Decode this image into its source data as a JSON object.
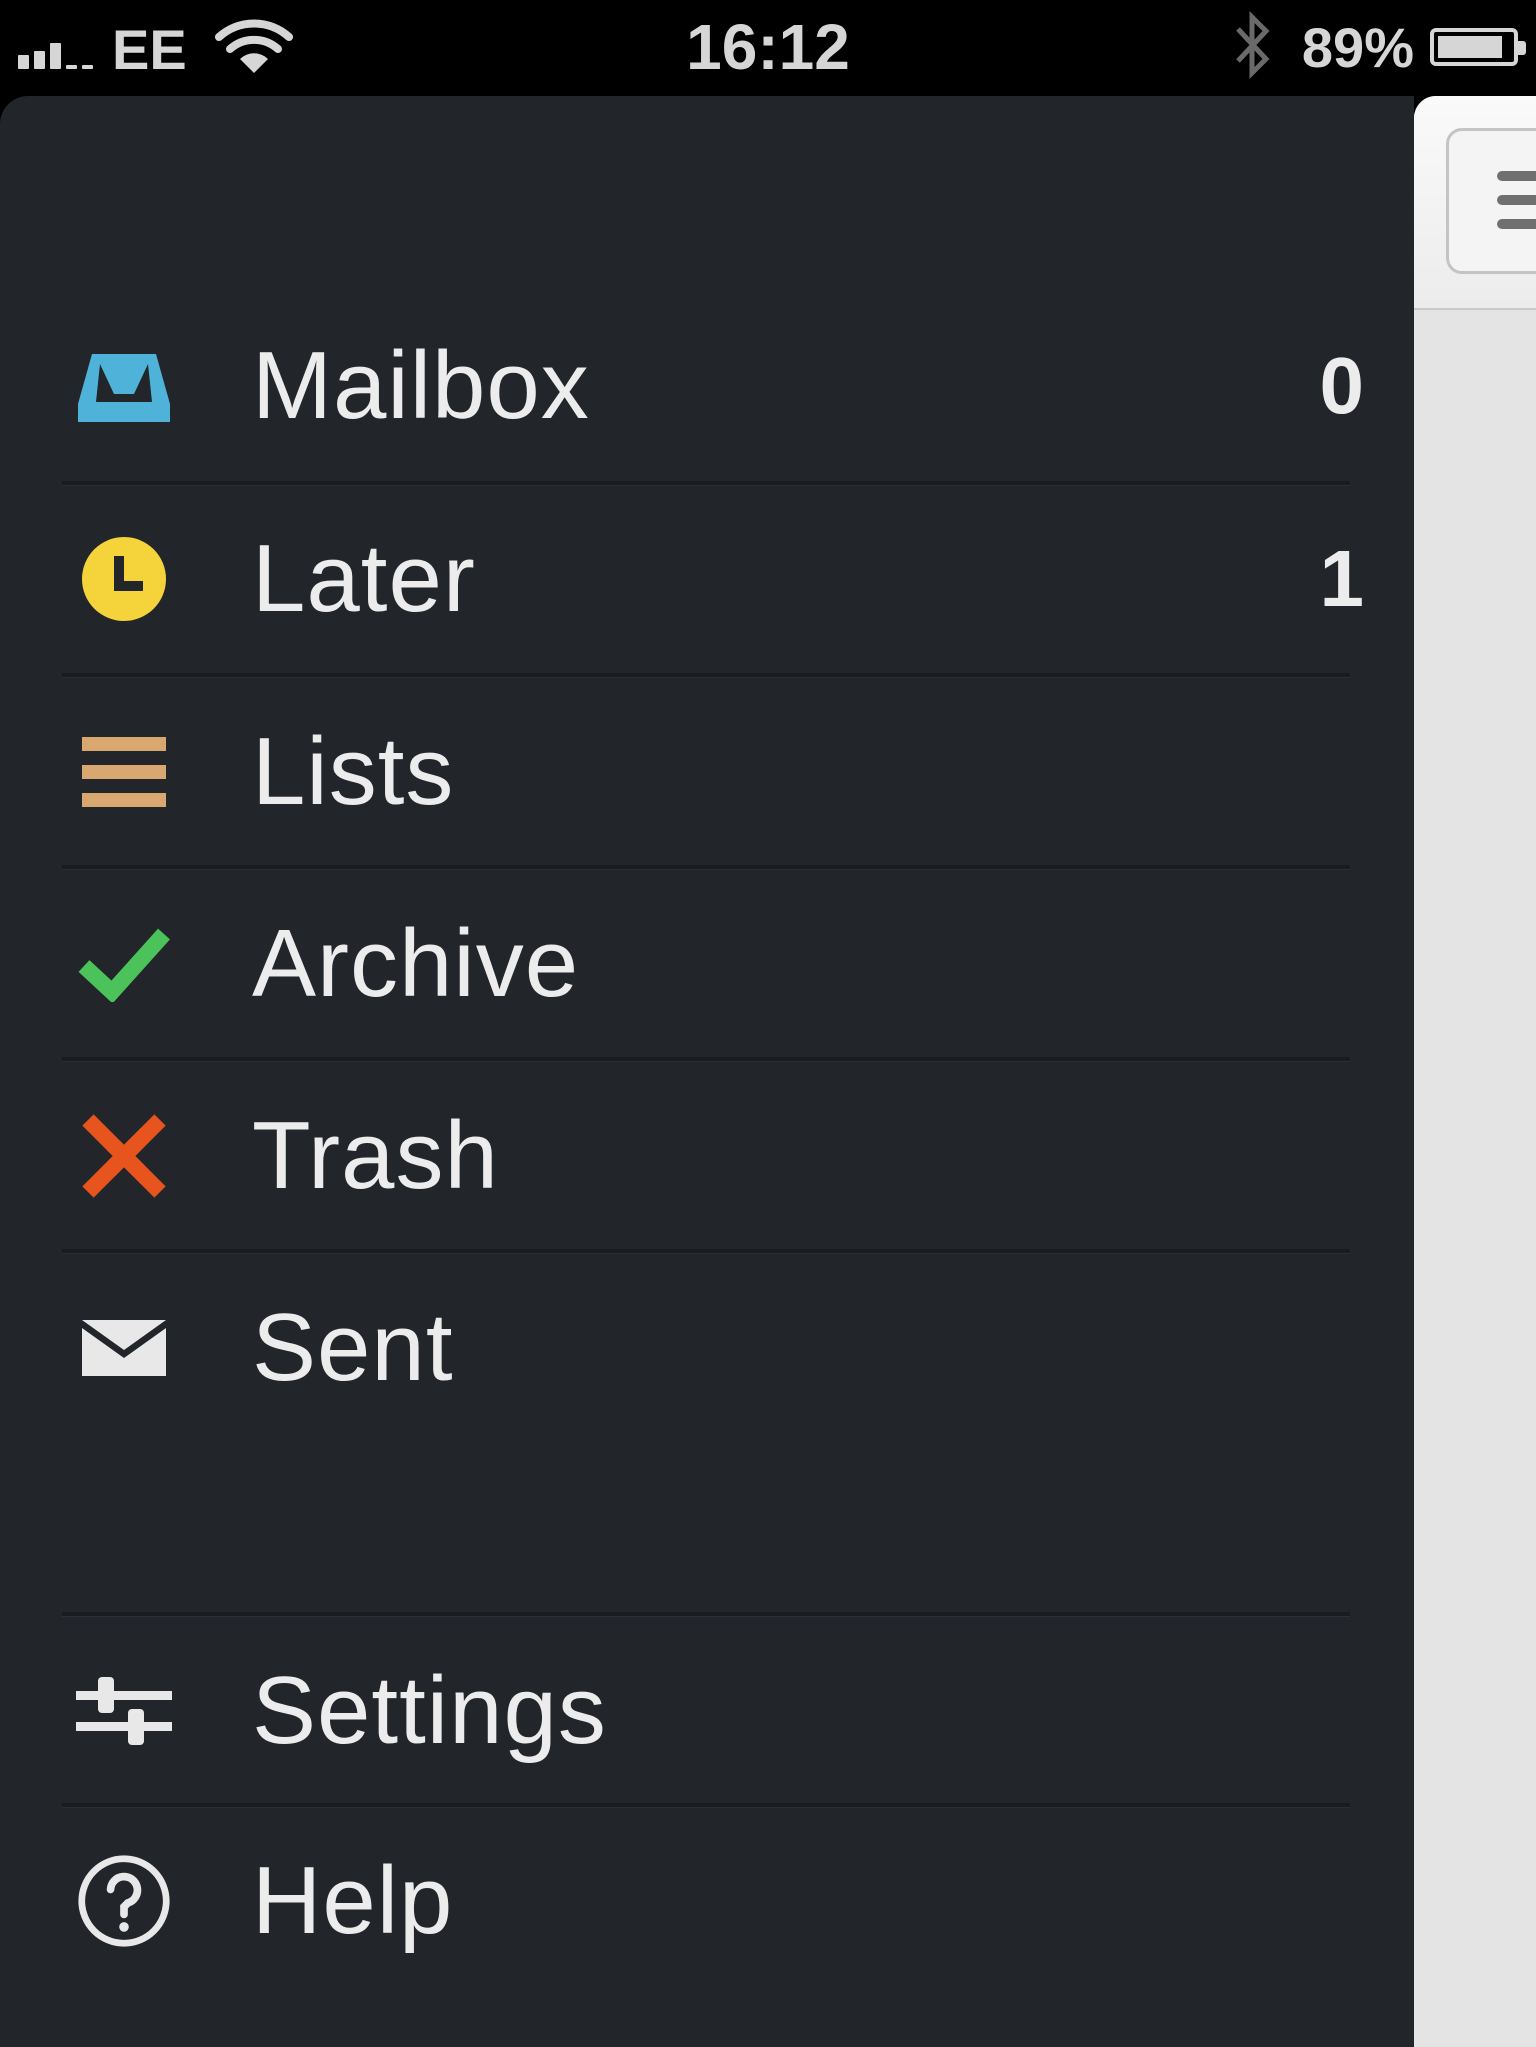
{
  "status_bar": {
    "carrier": "EE",
    "time": "16:12",
    "battery_percent": "89%",
    "battery_level": 0.89,
    "signal_bars": 3,
    "icons": [
      "signal-icon",
      "wifi-icon",
      "bluetooth-icon",
      "battery-icon"
    ]
  },
  "menu": {
    "items": [
      {
        "label": "Mailbox",
        "count": "0",
        "icon": "mailbox-tray-icon",
        "color": "#4fb3d9"
      },
      {
        "label": "Later",
        "count": "1",
        "icon": "clock-icon",
        "color": "#f5d33a"
      },
      {
        "label": "Lists",
        "icon": "lists-icon",
        "color": "#d9a871"
      },
      {
        "label": "Archive",
        "icon": "checkmark-icon",
        "color": "#4cc35a"
      },
      {
        "label": "Trash",
        "icon": "x-icon",
        "color": "#e8541e"
      },
      {
        "label": "Sent",
        "icon": "envelope-icon",
        "color": "#e8e8e8"
      },
      {
        "label": "Settings",
        "icon": "sliders-icon",
        "color": "#e8e8e8"
      },
      {
        "label": "Help",
        "icon": "help-icon",
        "color": "#e8e8e8"
      }
    ]
  },
  "colors": {
    "menu_background": "#22252a",
    "text": "#ececec",
    "main_view_background": "#e4e4e4"
  }
}
